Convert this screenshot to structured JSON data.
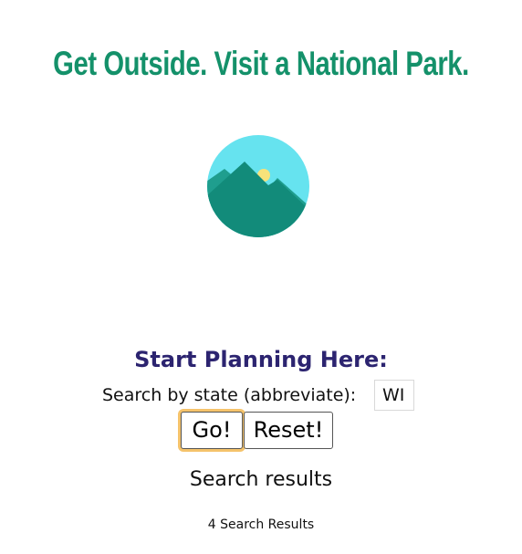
{
  "header": {
    "title": "Get Outside. Visit a National Park."
  },
  "logo": {
    "icon": "mountain-sun-icon",
    "colors": {
      "sky": "#66e3ef",
      "sun": "#f7e27a",
      "mountain_back": "#1f9e8e",
      "mountain_front": "#128b7a"
    }
  },
  "main": {
    "heading": "Start Planning Here:",
    "search": {
      "label": "Search by state (abbreviate):",
      "value": "WI"
    },
    "buttons": {
      "go_label": "Go!",
      "reset_label": "Reset!"
    },
    "results": {
      "heading": "Search results",
      "count_text": "4 Search Results"
    }
  },
  "colors": {
    "title": "#14916a",
    "heading": "#2c2470",
    "focus_ring": "#f5c36b"
  }
}
